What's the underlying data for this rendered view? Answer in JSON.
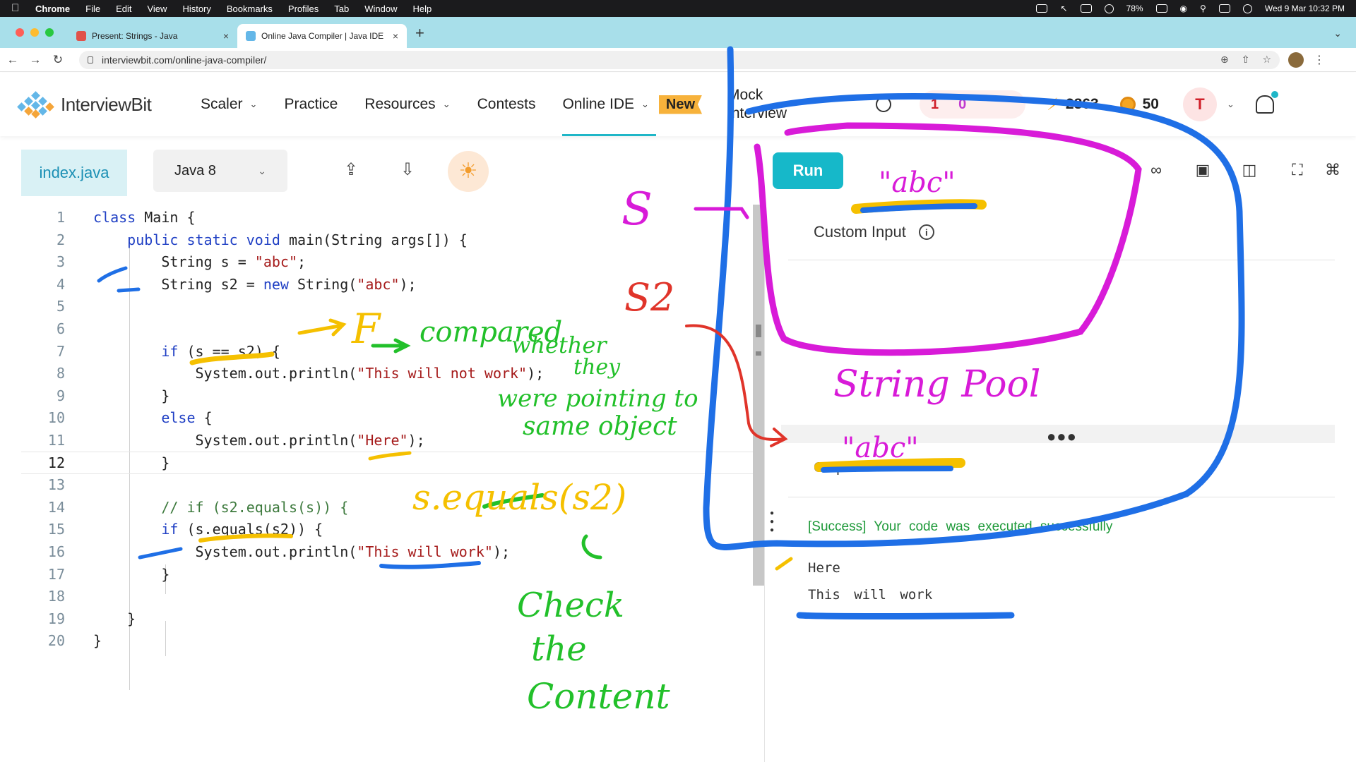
{
  "menubar": {
    "app": "Chrome",
    "items": [
      "File",
      "Edit",
      "View",
      "History",
      "Bookmarks",
      "Profiles",
      "Tab",
      "Window",
      "Help"
    ],
    "battery": "78%",
    "clock": "Wed 9 Mar  10:32 PM"
  },
  "browser": {
    "tabs": [
      {
        "title": "Present: Strings - Java",
        "favicon_color": "#e0524a"
      },
      {
        "title": "Online Java Compiler | Java IDE",
        "favicon_color": "#64b7e8"
      }
    ],
    "url": "interviewbit.com/online-java-compiler/"
  },
  "site": {
    "brand": "InterviewBit",
    "nav": [
      {
        "label": "Scaler",
        "has_menu": true
      },
      {
        "label": "Practice",
        "has_menu": false
      },
      {
        "label": "Resources",
        "has_menu": true
      },
      {
        "label": "Contests",
        "has_menu": false
      },
      {
        "label": "Online IDE",
        "has_menu": true
      }
    ],
    "new_badge": "New",
    "mock_interview": "Mock Interview",
    "streak": "1",
    "hearts": "0",
    "points": "2863",
    "coins": "50",
    "avatar_initial": "T",
    "accent": "#1fb6c7"
  },
  "editor": {
    "file_tab": "index.java",
    "language": "Java 8",
    "run_label": "Run",
    "current_line": 12,
    "lines": [
      "class Main {",
      "    public static void main(String args[]) {",
      "        String s = \"abc\";",
      "        String s2 = new String(\"abc\");",
      "",
      "",
      "        if (s == s2) {",
      "            System.out.println(\"This will not work\");",
      "        }",
      "        else {",
      "            System.out.println(\"Here\");",
      "        }",
      "",
      "        // if (s2.equals(s)) {",
      "        if (s.equals(s2)) {",
      "            System.out.println(\"This will work\");",
      "        }",
      "",
      "    }",
      "}"
    ]
  },
  "output_panel": {
    "custom_input_label": "Custom Input",
    "output_label": "Output",
    "success_message": "[Success]  Your  code  was  executed  successfully",
    "output_lines": [
      "Here",
      "This  will  work"
    ]
  },
  "annotations": {
    "s_label": "S",
    "s2_label": "S2",
    "f_label": "F",
    "compared": "compared",
    "whether": "whether",
    "they": "they",
    "were_pointing_to": "were pointing to",
    "same_object": "same object",
    "string_pool": "String Pool",
    "abc_1": "\"abc\"",
    "abc_2": "\"abc\"",
    "equals_expr": "s.equals(s2)",
    "check": "Check",
    "the": "the",
    "content": "Content"
  }
}
